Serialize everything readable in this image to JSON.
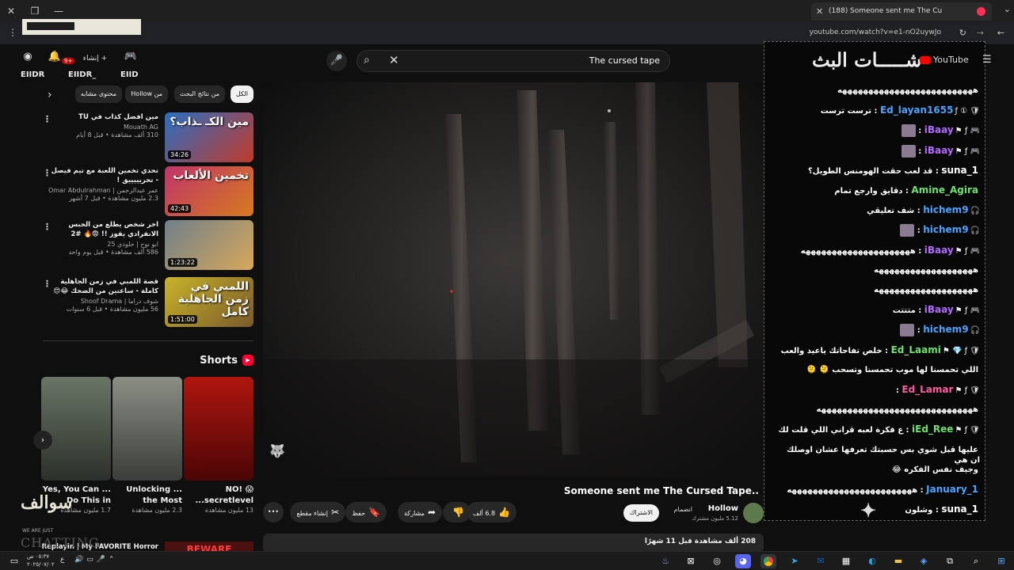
{
  "browser": {
    "tab_title": "(188) Someone sent me The Cu",
    "url": "youtube.com/watch?v=e1-nO2uywJo"
  },
  "header": {
    "search_query": "The cursed tape",
    "notification_count": "9+",
    "create_label": "إنشاء",
    "user_tags": [
      "EIIDR",
      "EIIDR_",
      "EIID"
    ]
  },
  "sidebar": {
    "chips": [
      "الكل",
      "من نتائج البحث",
      "من Hollow",
      "محتوى مشابه"
    ],
    "recommendations": [
      {
        "title": "مين افضل كذاب في TU",
        "channel": "Mouath AG",
        "meta": "310 ألف مشاهدة • قبل 8 أيام",
        "duration": "34:26",
        "overlay": "مين الكـ ـذاب؟",
        "color1": "#2a6fc2",
        "color2": "#c23a2a"
      },
      {
        "title": "تحدي تخمين اللعبة مع تيم فيصل - تحريييييق !",
        "channel": "عمر عبدالرحمن | Omar Abdulrahman",
        "meta": "2.3 مليون مشاهدة • قبل 7 أشهر",
        "duration": "42:43",
        "overlay": "تخمين الألعاب",
        "color1": "#c0356a",
        "color2": "#d67a1f"
      },
      {
        "title": "اخر شخص يطلع من الحبس الانفرادي يفوز !! 😨🔥 #2",
        "channel": "ابو نوح | حلودي 25",
        "meta": "586 ألف مشاهدة • قبل يوم واحد",
        "duration": "1:23:22",
        "overlay": "",
        "color1": "#6f7f8a",
        "color2": "#d8a85a"
      },
      {
        "title": "قصة اللمبي في زمن الجاهلية كاملة - ساعتين من الضحك 😂😍 محمد سعد - فيلم اطاطا",
        "channel": "شوف دراما | Shoof Drama",
        "meta": "56 مليون مشاهدة • قبل 6 سنوات",
        "duration": "1:51:00",
        "overlay": "اللمبي في زمن الجاهلية كامل",
        "color1": "#c8b22a",
        "color2": "#7a5a2a"
      }
    ],
    "shorts_title": "Shorts",
    "shorts": [
      {
        "title": "NO! 😱 ...secretlevel",
        "views": "13 مليون مشاهدة",
        "color1": "#b0160f",
        "color2": "#4a0505"
      },
      {
        "title": "Unlocking ... the Most",
        "views": "2.3 مليون مشاهدة",
        "color1": "#8a8f86",
        "color2": "#3a3d38"
      },
      {
        "title": "Yes, You Can ... Do This in",
        "views": "1.7 مليون مشاهدة",
        "color1": "#6a7566",
        "color2": "#2b302a"
      }
    ],
    "bottom_rec_title": "Replayin | My FAVORITE Horror",
    "bottom_rec_thumb": "BEWARE"
  },
  "video": {
    "title": "Someone sent me The Cursed Tape..",
    "channel": "Hollow",
    "subs": "5.12 مليون مشترك",
    "subscribe_label": "الاشتراك",
    "join_label": "انضمام",
    "likes": "6.8 ألف",
    "share_label": "مشاركة",
    "save_label": "حفظ",
    "clip_label": "إنشاء مقطع",
    "more_label": "•••",
    "description": "208 ألف مشاهدة قبل 11 شهرًا"
  },
  "chat": {
    "title": "شـــــات البث",
    "yt_label": "YouTube",
    "messages": [
      {
        "name": "",
        "msg": "ههههههههههههههههههههههههههه",
        "color": "#ffffff",
        "icons": ""
      },
      {
        "name": "Ed_layan1655",
        "msg": "ترست ترست",
        "color": "#4aa3ff",
        "icons": "🛡 ① ƒ"
      },
      {
        "name": "iBaay",
        "msg": "",
        "color": "#b36bff",
        "icons": "🎮 ƒ ⚑",
        "emote": true
      },
      {
        "name": "iBaay",
        "msg": "",
        "color": "#b36bff",
        "icons": "🎮 ƒ ⚑",
        "emote": true
      },
      {
        "name": "1_suna",
        "msg": "قد لعب حقت الهومنس الطويل؟",
        "color": "#ffffff",
        "icons": ""
      },
      {
        "name": "Amine_Agira",
        "msg": "دقايق وارجع تمام",
        "color": "#6ee26e",
        "icons": ""
      },
      {
        "name": "hichem9",
        "msg": "شف تعليقي",
        "color": "#4aa3ff",
        "icons": "🎧"
      },
      {
        "name": "hichem9",
        "msg": "",
        "color": "#4aa3ff",
        "icons": "🎧",
        "emote": true
      },
      {
        "name": "iBaay",
        "msg": "هههههههههههههههههههههه",
        "color": "#b36bff",
        "icons": "🎮 ƒ ⚑"
      },
      {
        "name": "",
        "msg": "هههههههههههههههههههه",
        "color": "#ffffff",
        "icons": ""
      },
      {
        "name": "",
        "msg": "هههههههههههههههههههه",
        "color": "#ffffff",
        "icons": ""
      },
      {
        "name": "iBaay",
        "msg": "متتتت",
        "color": "#b36bff",
        "icons": "🎮 ƒ ⚑"
      },
      {
        "name": "hichem9",
        "msg": "",
        "color": "#4aa3ff",
        "icons": "🎧",
        "emote": true
      },
      {
        "name": "Ed_Laami",
        "msg": "خلص تفاحاتك ياعيد والعب",
        "color": "#6ee26e",
        "icons": "🛡 ƒ 💎 ⚑"
      },
      {
        "name": "",
        "msg": "اللي تحمسنا لها موب تحمسنا وتسحب 🫠 🫠",
        "color": "#ffffff",
        "icons": ""
      },
      {
        "name": "Ed_Lamar",
        "msg": "",
        "color": "#ff5aa0",
        "icons": "🛡 ƒ ⚑"
      },
      {
        "name": "",
        "msg": "ههههههههههههههههههههههههههههههه",
        "color": "#ffffff",
        "icons": ""
      },
      {
        "name": "iEd_Ree",
        "msg": "ع فكرة لعبه قراني اللي قلت لك",
        "color": "#6ee26e",
        "icons": "🛡 ƒ ⚑"
      },
      {
        "name": "",
        "msg": "عليها قبل شوي بس حسبتك تعرفها عشان اوصلك ان هي",
        "color": "#ffffff",
        "icons": ""
      },
      {
        "name": "",
        "msg": "وجيف نفس الفكره 😂",
        "color": "#ffffff",
        "icons": ""
      },
      {
        "name": "January_1",
        "msg": "ههههههههههههههههههههههههه",
        "color": "#4aa3ff",
        "icons": ""
      },
      {
        "name": "1_suna",
        "msg": "وشلون",
        "color": "#ffffff",
        "icons": ""
      }
    ]
  },
  "overlay": {
    "watermark_bottom": "سوالف",
    "watermark_small": "WE ARE JUST",
    "watermark_chatting": "CHATTING"
  },
  "taskbar": {
    "time": "٠٥:٣٧ ص",
    "date": "٢٠٢٥/٠٧/٠٢",
    "lang": "ع"
  }
}
